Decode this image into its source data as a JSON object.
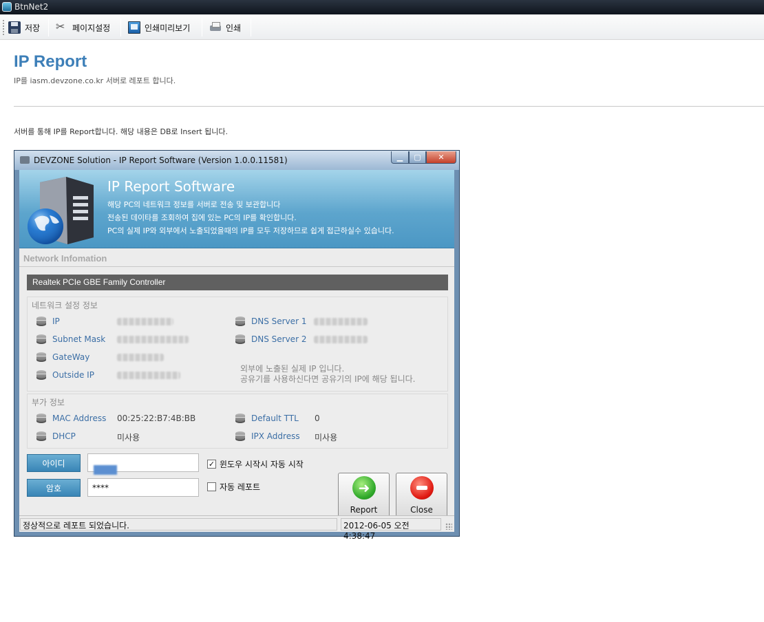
{
  "app": {
    "title": "BtnNet2",
    "icon": "app-icon"
  },
  "toolbar": {
    "items": [
      {
        "label": "저장",
        "icon": "save-icon"
      },
      {
        "label": "페이지설정",
        "icon": "tools-icon"
      },
      {
        "label": "인쇄미리보기",
        "icon": "print-preview-icon"
      },
      {
        "label": "인쇄",
        "icon": "printer-icon"
      }
    ]
  },
  "page": {
    "title": "IP Report",
    "subtitle": "IP를 iasm.devzone.co.kr 서버로 레포트 합니다.",
    "description": "서버를 통해 IP를 Report합니다. 해당 내용은 DB로 Insert 됩니다."
  },
  "window": {
    "title": "DEVZONE Solution - IP Report Software (Version 1.0.0.11581)",
    "controls": {
      "minimize": "minimize-icon",
      "maximize": "maximize-icon",
      "close": "close-icon"
    },
    "hero": {
      "title": "IP Report Software",
      "lines": [
        "해당 PC의 네트워크 정보를 서버로 전송 및 보관합니다",
        "전송된 데이타를 조회하여 집에 있는 PC의 IP를 확인합니다.",
        "PC의 실제 IP와 외부에서 노출되었을때의 IP를 모두 저장하므로 쉽게 접근하실수 있습니다."
      ]
    },
    "section_title": "Network Infomation",
    "adapter": "Realtek PCIe GBE Family Controller",
    "network_group": {
      "title": "네트워크 설정 정보",
      "ip_label": "IP",
      "subnet_label": "Subnet Mask",
      "gateway_label": "GateWay",
      "outside_label": "Outside IP",
      "dns1_label": "DNS Server 1",
      "dns2_label": "DNS Server 2",
      "note_line1": "외부에 노출된 실제 IP 입니다.",
      "note_line2": "공유기를 사용하신다면 공유기의 IP에 해당 됩니다."
    },
    "extra_group": {
      "title": "부가 정보",
      "mac_label": "MAC Address",
      "mac_value": "00:25:22:B7:4B:BB",
      "dhcp_label": "DHCP",
      "dhcp_value": "미사용",
      "ttl_label": "Default TTL",
      "ttl_value": "0",
      "ipx_label": "IPX Address",
      "ipx_value": "미사용"
    },
    "login": {
      "id_label": "아이디",
      "pw_label": "암호",
      "pw_value": "****"
    },
    "options": {
      "autostart_label": "윈도우 시작시 자동 시작",
      "autostart_checked": true,
      "autoreport_label": "자동 레포트",
      "autoreport_checked": false
    },
    "buttons": {
      "report": "Report",
      "close": "Close"
    },
    "status": {
      "message": "정상적으로 레포트 되었습니다.",
      "datetime": "2012-06-05 오전 4:38:47"
    }
  }
}
